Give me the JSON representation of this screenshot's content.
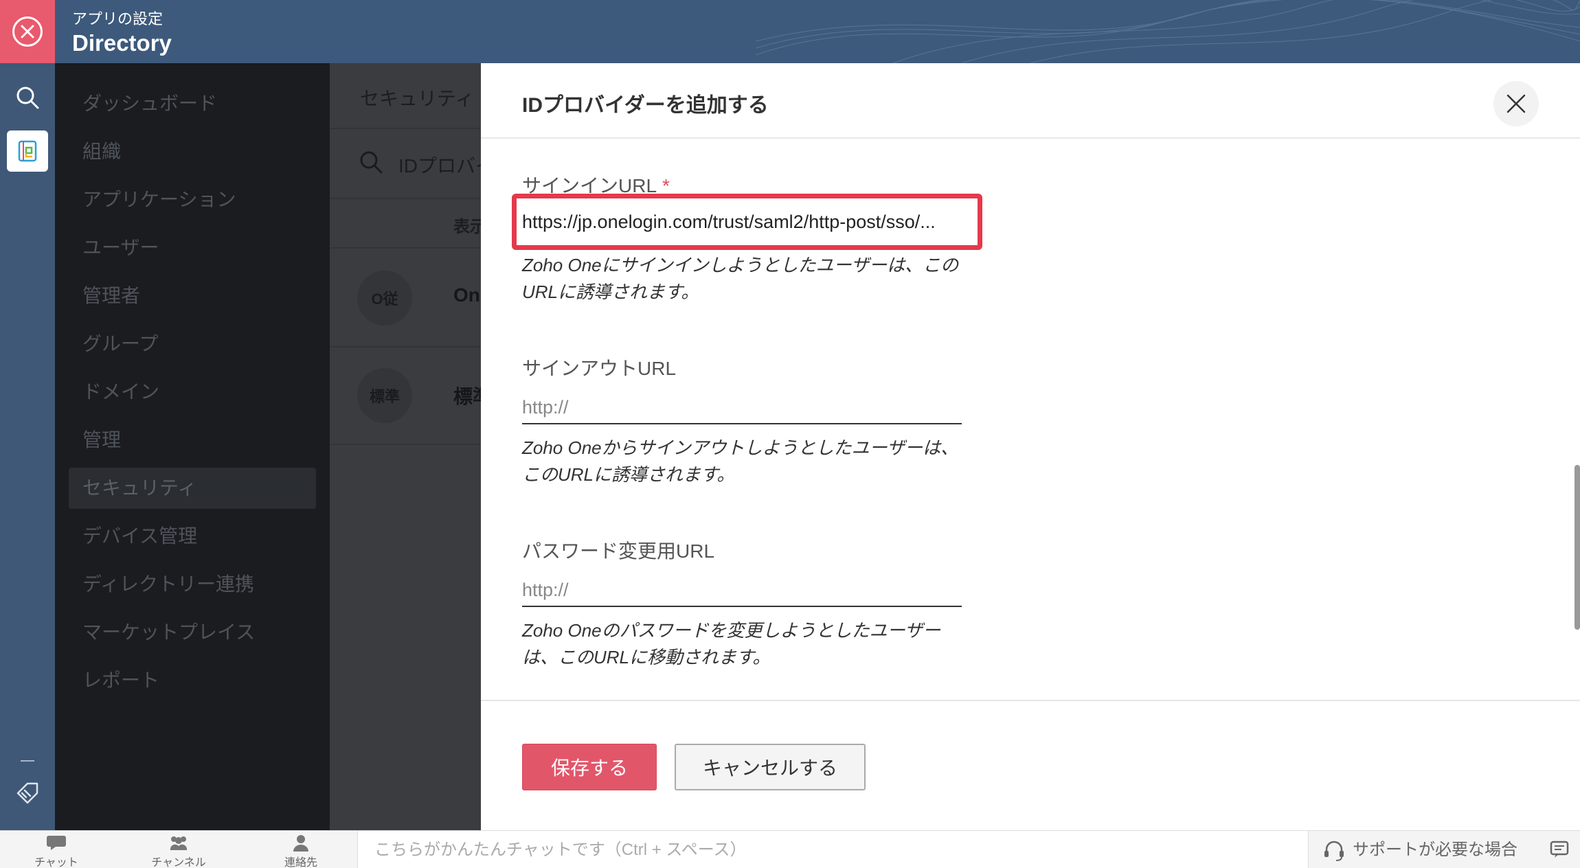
{
  "header": {
    "subtitle": "アプリの設定",
    "title": "Directory"
  },
  "sidebar": {
    "items": [
      {
        "label": "ダッシュボード"
      },
      {
        "label": "組織"
      },
      {
        "label": "アプリケーション"
      },
      {
        "label": "ユーザー"
      },
      {
        "label": "管理者"
      },
      {
        "label": "グループ"
      },
      {
        "label": "ドメイン"
      },
      {
        "label": "管理"
      },
      {
        "label": "セキュリティ",
        "active": true
      },
      {
        "label": "デバイス管理"
      },
      {
        "label": "ディレクトリー連携"
      },
      {
        "label": "マーケットプレイス"
      },
      {
        "label": "レポート"
      }
    ]
  },
  "middle": {
    "header": "セキュリティ",
    "search_placeholder": "IDプロバイダー",
    "column": "表示",
    "rows": [
      {
        "avatar": "O従",
        "name": "On"
      },
      {
        "avatar": "標準",
        "name": "標準"
      }
    ]
  },
  "panel": {
    "title": "IDプロバイダーを追加する",
    "signin": {
      "label": "サインインURL",
      "required_mark": "*",
      "value": "https://jp.onelogin.com/trust/saml2/http-post/sso/...",
      "hint": "Zoho Oneにサインインしようとしたユーザーは、このURLに誘導されます。"
    },
    "signout": {
      "label": "サインアウトURL",
      "placeholder": "http://",
      "hint": "Zoho Oneからサインアウトしようとしたユーザーは、このURLに誘導されます。"
    },
    "password": {
      "label": "パスワード変更用URL",
      "placeholder": "http://",
      "hint": "Zoho Oneのパスワードを変更しようとしたユーザーは、このURLに移動されます。"
    },
    "save_label": "保存する",
    "cancel_label": "キャンセルする"
  },
  "bottombar": {
    "chat": "チャット",
    "channels": "チャンネル",
    "contacts": "連絡先",
    "chat_placeholder": "こちらがかんたんチャットです（Ctrl + スペース）",
    "support": "サポートが必要な場合"
  },
  "colors": {
    "header_bg": "#3d5a7c",
    "accent": "#e2566a",
    "highlight": "#e33a4b",
    "sidebar_bg": "#1a1c20"
  }
}
